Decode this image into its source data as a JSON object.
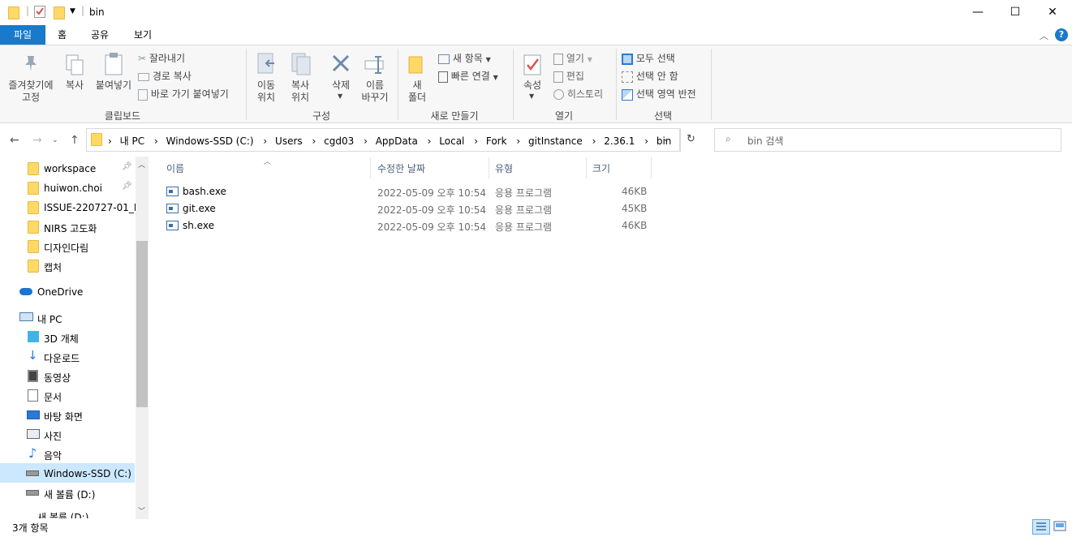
{
  "window": {
    "title": "bin",
    "minimize": "—",
    "maximize": "☐",
    "close": "✕"
  },
  "tabs": [
    {
      "label": "파일"
    },
    {
      "label": "홈"
    },
    {
      "label": "공유"
    },
    {
      "label": "보기"
    }
  ],
  "ribbon": {
    "clipboard": {
      "pin": "즐겨찾기에\n고정",
      "copy": "복사",
      "paste": "붙여넣기",
      "cut": "잘라내기",
      "copy_path": "경로 복사",
      "paste_shortcut": "바로 가기 붙여넣기",
      "group": "클립보드"
    },
    "organize": {
      "move_to": "이동\n위치",
      "copy_to": "복사\n위치",
      "delete": "삭제",
      "rename": "이름\n바꾸기",
      "group": "구성"
    },
    "new": {
      "new_folder": "새\n폴더",
      "new_item": "새 항목",
      "easy_access": "빠른 연결",
      "group": "새로 만들기"
    },
    "open": {
      "properties": "속성",
      "open": "열기",
      "edit": "편집",
      "history": "히스토리",
      "group": "열기"
    },
    "select": {
      "select_all": "모두 선택",
      "select_none": "선택 안 함",
      "invert": "선택 영역 반전",
      "group": "선택"
    }
  },
  "address": {
    "crumbs": [
      "내 PC",
      "Windows-SSD (C:)",
      "Users",
      "cgd03",
      "AppData",
      "Local",
      "Fork",
      "gitInstance",
      "2.36.1",
      "bin"
    ],
    "search_placeholder": "bin 검색"
  },
  "nav_pane": {
    "items": [
      {
        "label": "workspace",
        "pinned": true,
        "icon": "folder-icon"
      },
      {
        "label": "huiwon.choi",
        "pinned": true,
        "icon": "folder-icon"
      },
      {
        "label": "ISSUE-220727-01_IB",
        "pinned": false,
        "icon": "folder-icon"
      },
      {
        "label": "NIRS 고도화",
        "pinned": false,
        "icon": "folder-icon"
      },
      {
        "label": "디자인다림",
        "pinned": false,
        "icon": "folder-icon"
      },
      {
        "label": "캡처",
        "pinned": false,
        "icon": "folder-icon"
      },
      {
        "label": "OneDrive",
        "icon": "cloud-icon"
      },
      {
        "label": "내 PC",
        "icon": "computer-icon"
      },
      {
        "label": "3D 개체",
        "icon": "cube-icon"
      },
      {
        "label": "다운로드",
        "icon": "download-icon"
      },
      {
        "label": "동영상",
        "icon": "video-icon"
      },
      {
        "label": "문서",
        "icon": "document-icon"
      },
      {
        "label": "바탕 화면",
        "icon": "desktop-icon"
      },
      {
        "label": "사진",
        "icon": "picture-icon"
      },
      {
        "label": "음악",
        "icon": "music-icon"
      },
      {
        "label": "Windows-SSD (C:)",
        "icon": "drive-icon",
        "selected": true
      },
      {
        "label": "새 볼륨 (D:)",
        "icon": "drive-icon"
      },
      {
        "label": "새 볼륨 (D:)",
        "icon": "drive-icon"
      }
    ]
  },
  "file_list": {
    "columns": [
      "이름",
      "수정한 날짜",
      "유형",
      "크기"
    ],
    "rows": [
      {
        "name": "bash.exe",
        "date": "2022-05-09 오후 10:54",
        "type": "응용 프로그램",
        "size": "46KB"
      },
      {
        "name": "git.exe",
        "date": "2022-05-09 오후 10:54",
        "type": "응용 프로그램",
        "size": "45KB"
      },
      {
        "name": "sh.exe",
        "date": "2022-05-09 오후 10:54",
        "type": "응용 프로그램",
        "size": "46KB"
      }
    ]
  },
  "status": {
    "count": "3개 항목"
  },
  "colors": {
    "accent": "#1979ca",
    "selected_nav": "#cce8ff",
    "ribbon_bg": "#f7f7f7"
  }
}
